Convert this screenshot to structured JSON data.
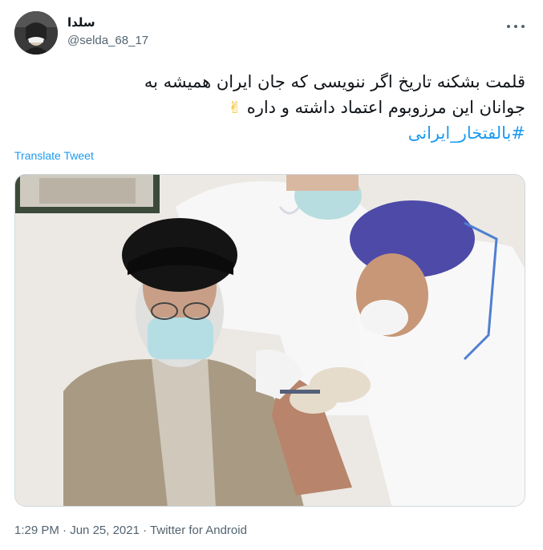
{
  "user": {
    "display_name": "سلدا",
    "handle": "@selda_68_17",
    "avatar_icon": "profile-photo-avatar"
  },
  "tweet": {
    "line1": "قلمت بشکنه تاریخ اگر ننویسی که جان ایران همیشه به",
    "line2": "جوانان این مرزوبوم اعتماد داشته و داره",
    "emoji": "✌",
    "hashtag": "#بالفتخار_ایرانی"
  },
  "translate_label": "Translate Tweet",
  "meta": {
    "time": "1:29 PM",
    "separator": " · ",
    "date": "Jun 25, 2021",
    "source": "Twitter for Android"
  },
  "colors": {
    "link": "#1d9bf0",
    "secondary_text": "#536471",
    "primary_text": "#0f1419"
  }
}
